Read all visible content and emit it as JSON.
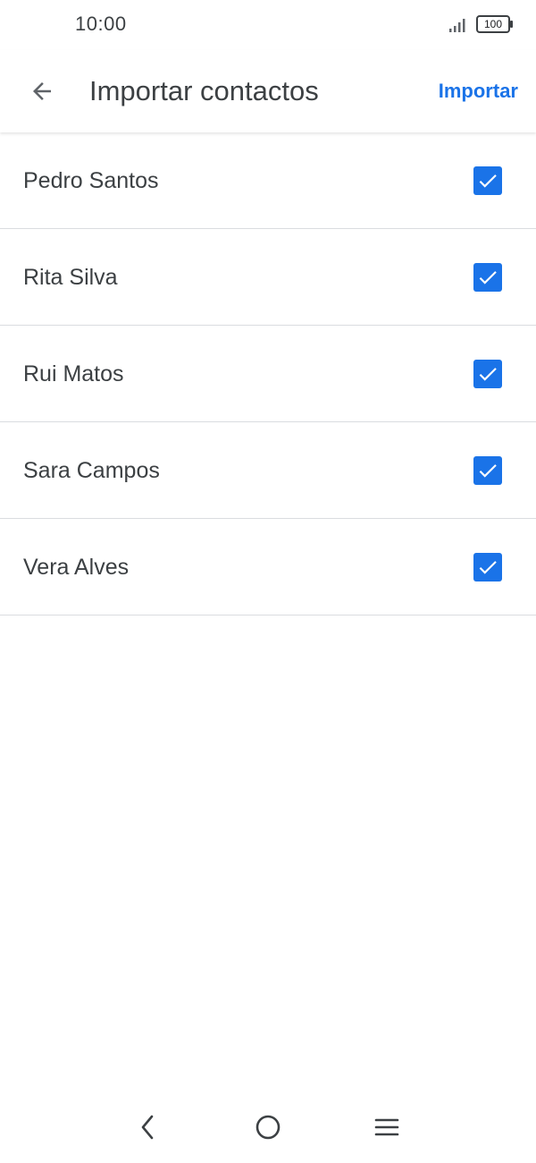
{
  "status_bar": {
    "time": "10:00",
    "battery": "100",
    "signal_icon": "signal-icon",
    "battery_icon": "battery-icon"
  },
  "app_bar": {
    "back_icon": "arrow-left-icon",
    "title": "Importar contactos",
    "action_label": "Importar"
  },
  "contacts": [
    {
      "name": "Pedro Santos",
      "checked": true
    },
    {
      "name": "Rita Silva",
      "checked": true
    },
    {
      "name": "Rui Matos",
      "checked": true
    },
    {
      "name": "Sara Campos",
      "checked": true
    },
    {
      "name": "Vera Alves",
      "checked": true
    }
  ],
  "nav_bar": {
    "back_icon": "nav-back-icon",
    "home_icon": "nav-home-icon",
    "menu_icon": "nav-menu-icon"
  },
  "colors": {
    "accent": "#1a73e8",
    "text": "#3c4043",
    "divider": "#dadce0",
    "background": "#ffffff"
  }
}
